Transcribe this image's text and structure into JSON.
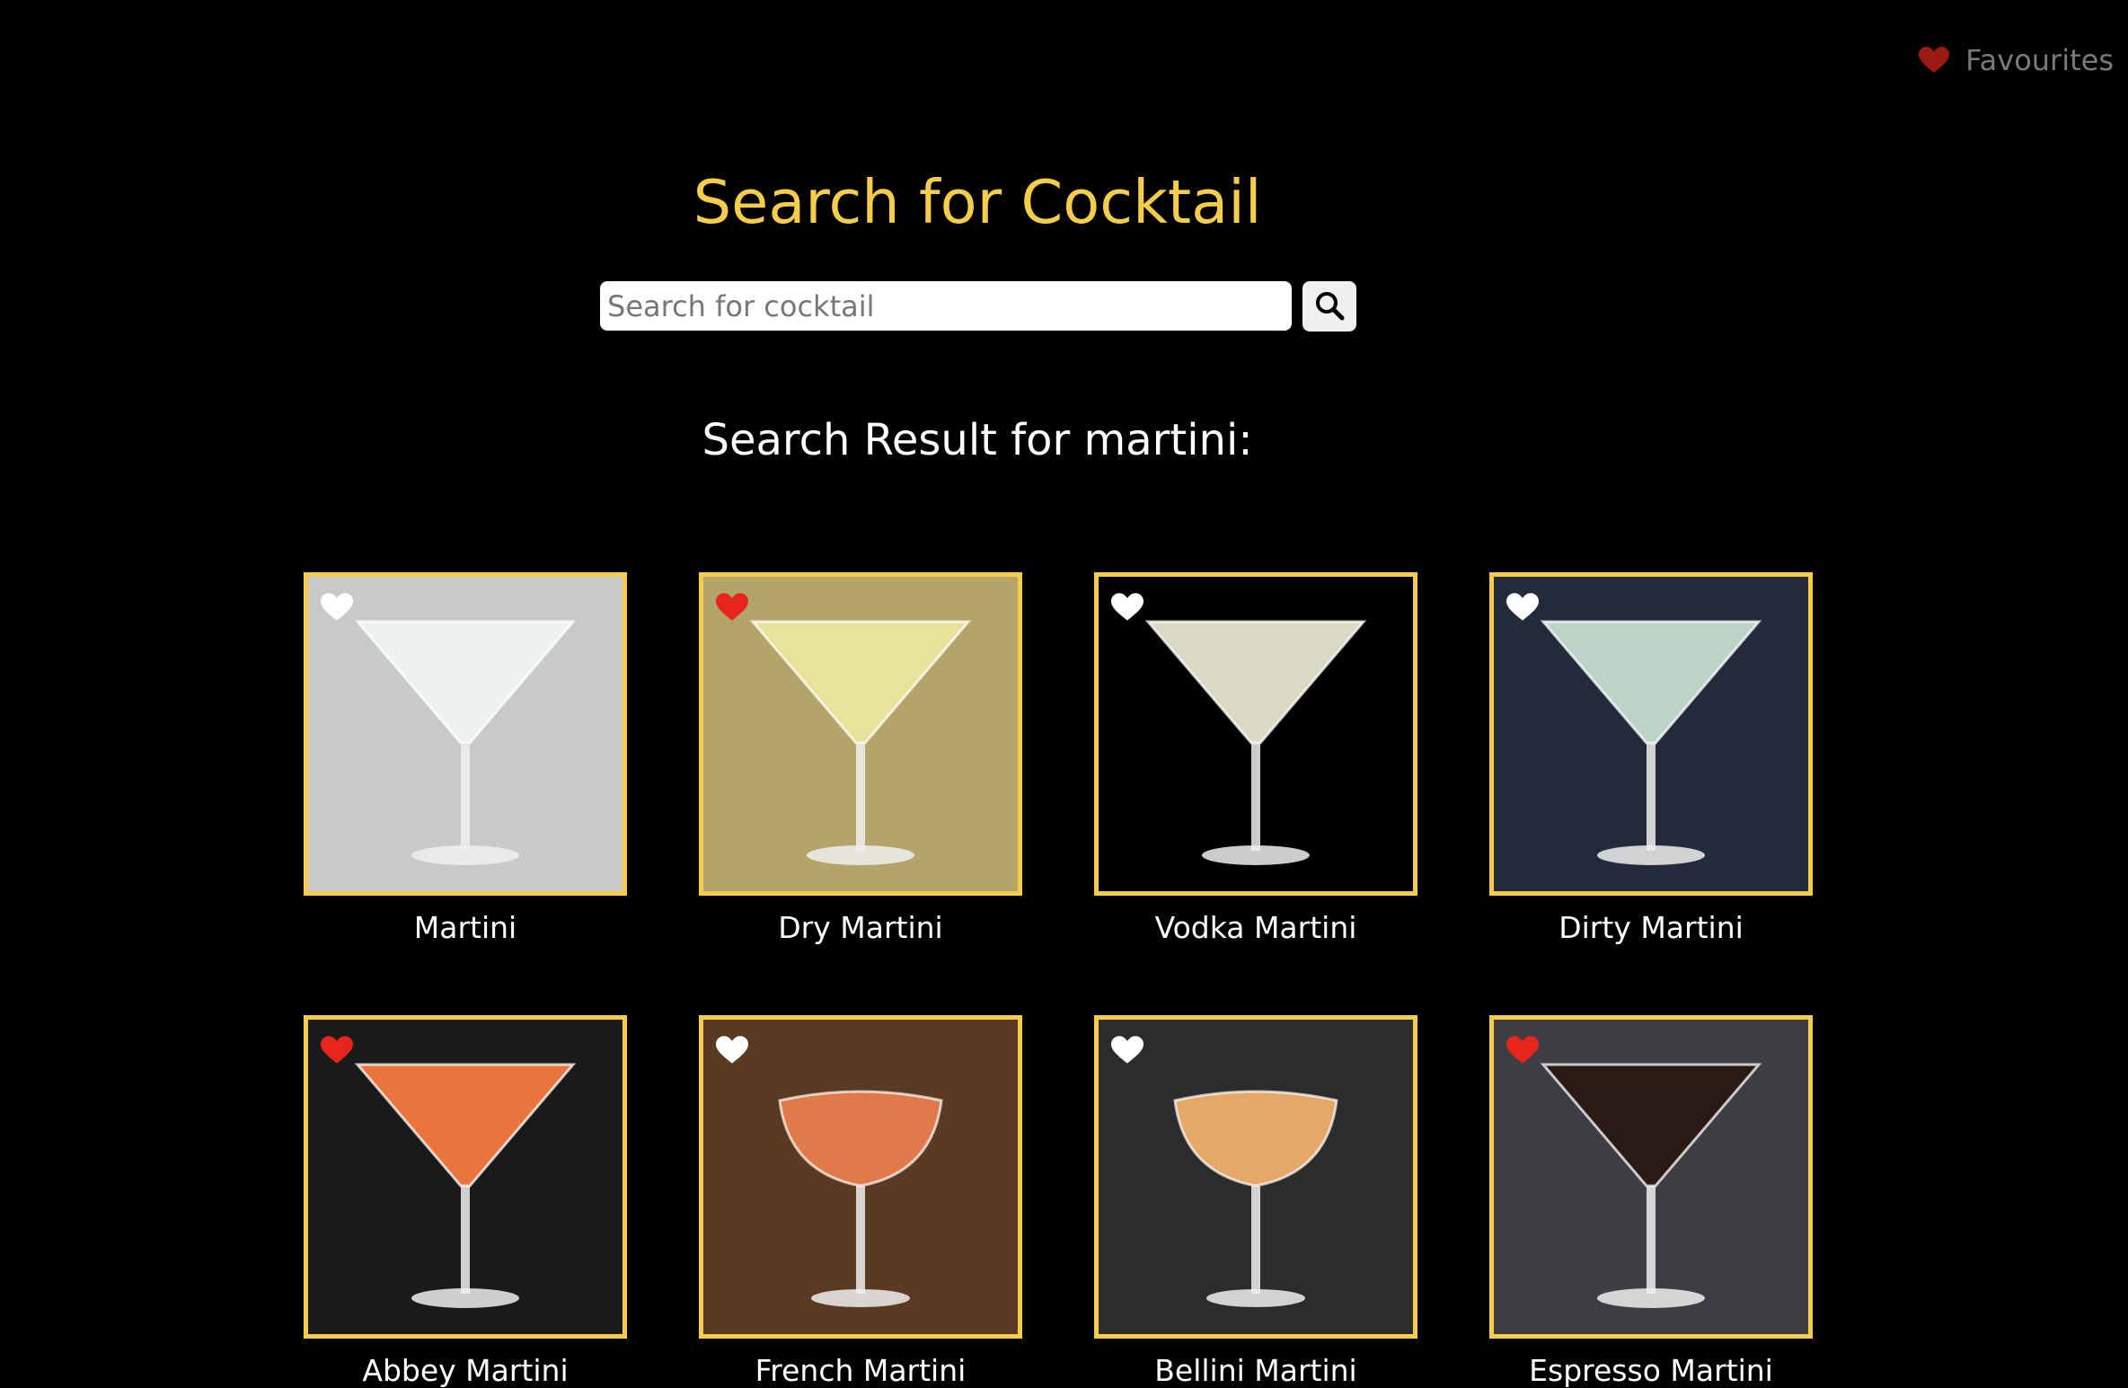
{
  "header": {
    "favourites_label": "Favourites",
    "favourites_icon": "heart-icon",
    "favourites_icon_color": "#9b1b14"
  },
  "search": {
    "title": "Search for Cocktail",
    "placeholder": "Search for cocktail",
    "value": "",
    "button_icon": "search-icon"
  },
  "results": {
    "heading": "Search Result for martini:",
    "items": [
      {
        "name": "Martini",
        "favourited": false,
        "bg": "#c9c9c9",
        "drink_color": "#eef2ee"
      },
      {
        "name": "Dry Martini",
        "favourited": true,
        "bg": "#b3a46a",
        "drink_color": "#e8e39a"
      },
      {
        "name": "Vodka Martini",
        "favourited": false,
        "bg": "#000000",
        "drink_color": "#d9d9c4"
      },
      {
        "name": "Dirty Martini",
        "favourited": false,
        "bg": "#232a3a",
        "drink_color": "#bcd3c8"
      },
      {
        "name": "Abbey Martini",
        "favourited": true,
        "bg": "#1a1a1a",
        "drink_color": "#e8743e"
      },
      {
        "name": "French Martini",
        "favourited": false,
        "bg": "#5a3a22",
        "drink_color": "#e07a4a"
      },
      {
        "name": "Bellini Martini",
        "favourited": false,
        "bg": "#2c2c2c",
        "drink_color": "#e6a868"
      },
      {
        "name": "Espresso Martini",
        "favourited": true,
        "bg": "#3d3d44",
        "drink_color": "#2a1a14"
      }
    ]
  },
  "colors": {
    "accent": "#f5cd4a",
    "heart_active": "#e8251c",
    "heart_inactive": "#ffffff",
    "background": "#000000"
  }
}
